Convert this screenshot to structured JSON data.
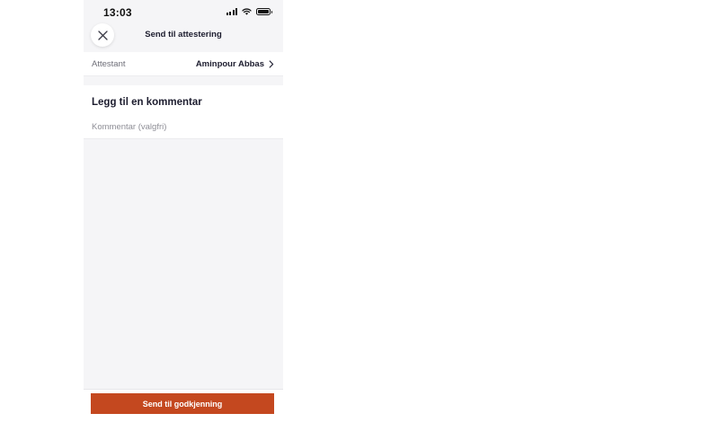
{
  "status_bar": {
    "time": "13:03",
    "icons": [
      "signal-icon",
      "wifi-icon",
      "battery-icon"
    ]
  },
  "header": {
    "title": "Send til attestering",
    "close_icon": "close-icon"
  },
  "attestant": {
    "label": "Attestant",
    "value": "Aminpour Abbas",
    "icon": "chevron-right-icon"
  },
  "comment": {
    "heading": "Legg til en kommentar",
    "value": "",
    "placeholder": "Kommentar (valgfri)"
  },
  "actions": {
    "submit_label": "Send til godkjenning"
  },
  "colors": {
    "accent": "#c4481f",
    "background": "#f5f5f7",
    "text_primary": "#1c1c2e",
    "text_secondary": "#6e6e78"
  }
}
